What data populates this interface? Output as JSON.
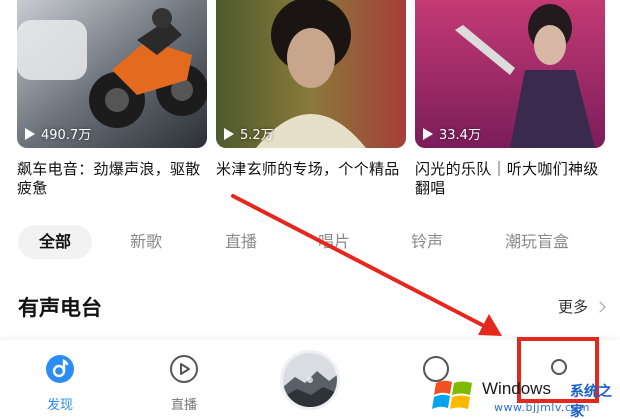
{
  "playlists": [
    {
      "plays": "490.7万",
      "title": "飙车电音：劲爆声浪，驱散疲惫"
    },
    {
      "plays": "5.2万",
      "title": "米津玄师的专场，个个精品"
    },
    {
      "plays": "33.4万",
      "title": "闪光的乐队｜听大咖们神级翻唱"
    }
  ],
  "tabs": [
    "全部",
    "新歌",
    "直播",
    "唱片",
    "铃声",
    "潮玩盲盒"
  ],
  "section": {
    "heading": "有声电台",
    "more": "更多"
  },
  "bottom_nav": {
    "discover": "发现",
    "live": "直播"
  },
  "colors": {
    "accent": "#2b8cf5",
    "annotation": "#e5281e"
  },
  "watermark": {
    "name": "Windows",
    "site": "系统之家",
    "url": "www.bjjmlv.com"
  }
}
